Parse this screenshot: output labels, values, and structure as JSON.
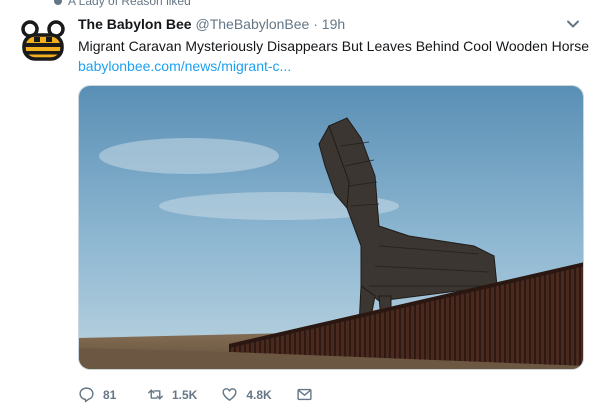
{
  "context": {
    "text": "A Lady of Reason liked"
  },
  "tweet": {
    "author_name": "The Babylon Bee",
    "handle": "@TheBabylonBee",
    "separator": "·",
    "time": "19h",
    "text": "Migrant Caravan Mysteriously Disappears But Leaves Behind Cool Wooden Horse",
    "link": "babylonbee.com/news/migrant-c...",
    "avatar_icon": "bee-logo-icon",
    "accent_color": "#1da1f2",
    "bee_color": "#f2b01e"
  },
  "actions": {
    "reply_count": "81",
    "retweet_count": "1.5K",
    "like_count": "4.8K"
  }
}
